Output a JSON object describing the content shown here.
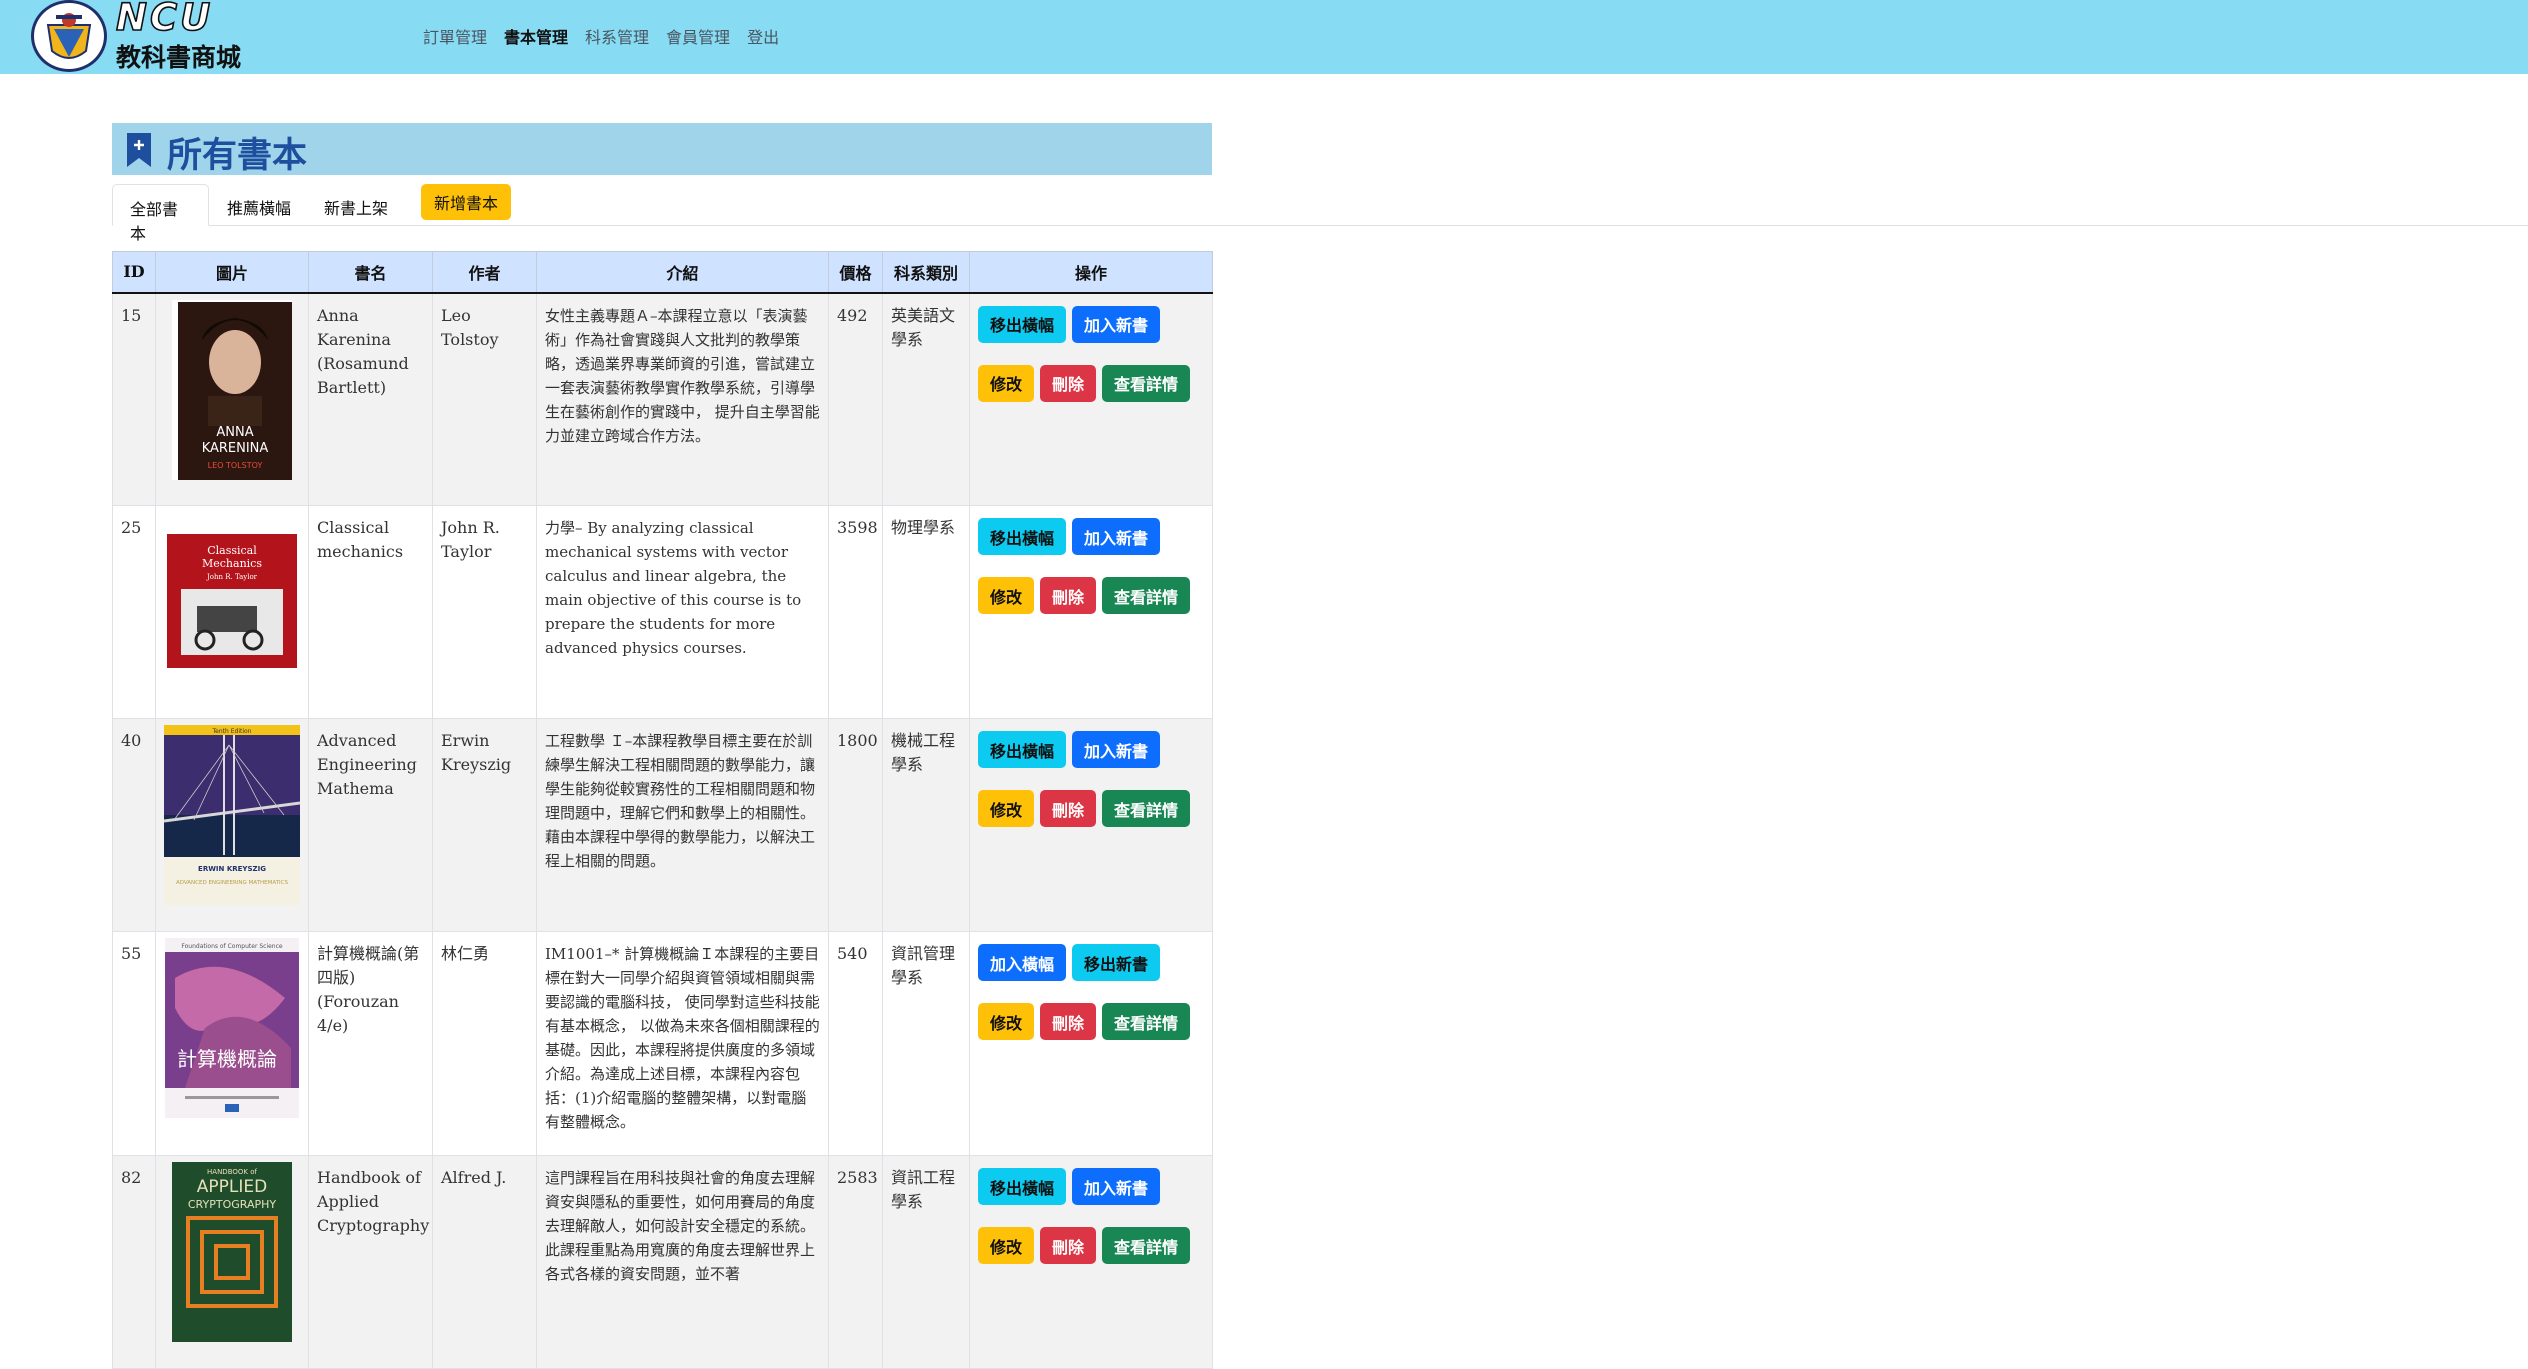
{
  "brand": {
    "title": "NCU",
    "subtitle": "教科書商城",
    "logo_icon": "ncu-emblem-icon"
  },
  "nav": [
    {
      "label": "訂單管理",
      "active": false
    },
    {
      "label": "書本管理",
      "active": true
    },
    {
      "label": "科系管理",
      "active": false
    },
    {
      "label": "會員管理",
      "active": false
    },
    {
      "label": "登出",
      "active": false
    }
  ],
  "page": {
    "title": "所有書本",
    "icon": "bookmark-plus-icon"
  },
  "tabs": {
    "all": "全部書本",
    "recommended": "推薦橫幅",
    "new": "新書上架",
    "add_button": "新增書本"
  },
  "table": {
    "headers": {
      "id": "ID",
      "image": "圖片",
      "name": "書名",
      "author": "作者",
      "intro": "介紹",
      "price": "價格",
      "dept": "科系類別",
      "ops": "操作"
    },
    "buttons": {
      "edit": "修改",
      "delete": "刪除",
      "detail": "查看詳情"
    },
    "rows": [
      {
        "id": "15",
        "name": "Anna Karenina (Rosamund Bartlett)",
        "author": "Leo Tolstoy",
        "intro": "女性主義專題Ａ–本課程立意以「表演藝術」作為社會實踐與人文批判的教學策略，透過業界專業師資的引進，嘗試建立一套表演藝術教學實作教學系統，引導學生在藝術創作的實踐中， 提升自主學習能力並建立跨域合作方法。",
        "price": "492",
        "dept": "英美語文學系",
        "btn1": "移出橫幅",
        "btn2": "加入新書",
        "cover": {
          "text1": "ANNA",
          "text2": "KARENINA",
          "text3": "LEO TOLSTOY",
          "bg": "#2b1710",
          "accent": "#c0392b"
        }
      },
      {
        "id": "25",
        "name": "Classical mechanics",
        "author": "John R. Taylor",
        "intro": "力學– By analyzing classical mechanical systems with vector calculus and linear algebra, the main objective of this course is to prepare the students for more advanced physics courses.",
        "price": "3598",
        "dept": "物理學系",
        "btn1": "移出橫幅",
        "btn2": "加入新書",
        "cover": {
          "text1": "Classical",
          "text2": "Mechanics",
          "text3": "John R. Taylor",
          "bg": "#b3141c",
          "accent": "#ffffff"
        }
      },
      {
        "id": "40",
        "name": "Advanced Engineering Mathema",
        "author": "Erwin Kreyszig",
        "intro": "工程數學 Ｉ–本課程教學目標主要在於訓練學生解決工程相關問題的數學能力，讓學生能夠從較實務性的工程相關問題和物理問題中，理解它們和數學上的相關性。藉由本課程中學得的數學能力，以解決工程上相關的問題。",
        "price": "1800",
        "dept": "機械工程學系",
        "btn1": "移出橫幅",
        "btn2": "加入新書",
        "cover": {
          "text1": "Tenth Edition",
          "text2": "ERWIN KREYSZIG",
          "text3": "ADVANCED ENGINEERING MATHEMATICS",
          "bg": "#3b2d6e",
          "accent": "#f2c218"
        }
      },
      {
        "id": "55",
        "name": "計算機概論(第四版) (Forouzan 4/e)",
        "author": "林仁勇",
        "intro": "IM1001–* 計算機概論Ｉ本課程的主要目標在對大一同學介紹與資管領域相關與需要認識的電腦科技， 使同學對這些科技能有基本概念， 以做為未來各個相關課程的基礎。因此，本課程將提供廣度的多領域介紹。為達成上述目標，本課程內容包括：(1)介紹電腦的整體架構，以對電腦有整體概念。",
        "price": "540",
        "dept": "資訊管理學系",
        "btn1": "加入橫幅",
        "btn2": "移出新書",
        "cover": {
          "text1": "Foundations of Computer Science",
          "text2": "計算機概論",
          "text3": "",
          "bg": "#7a3f8c",
          "accent": "#d8a0c8"
        }
      },
      {
        "id": "82",
        "name": "Handbook of Applied Cryptography",
        "author": "Alfred J.",
        "intro": "這門課程旨在用科技與社會的角度去理解資安與隱私的重要性，如何用賽局的角度去理解敵人，如何設計安全穩定的系統。此課程重點為用寬廣的角度去理解世界上各式各樣的資安問題，並不著",
        "price": "2583",
        "dept": "資訊工程學系",
        "btn1": "移出橫幅",
        "btn2": "加入新書",
        "cover": {
          "text1": "HANDBOOK of",
          "text2": "APPLIED",
          "text3": "CRYPTOGRAPHY",
          "bg": "#1f4d2c",
          "accent": "#e67e22"
        }
      }
    ]
  }
}
